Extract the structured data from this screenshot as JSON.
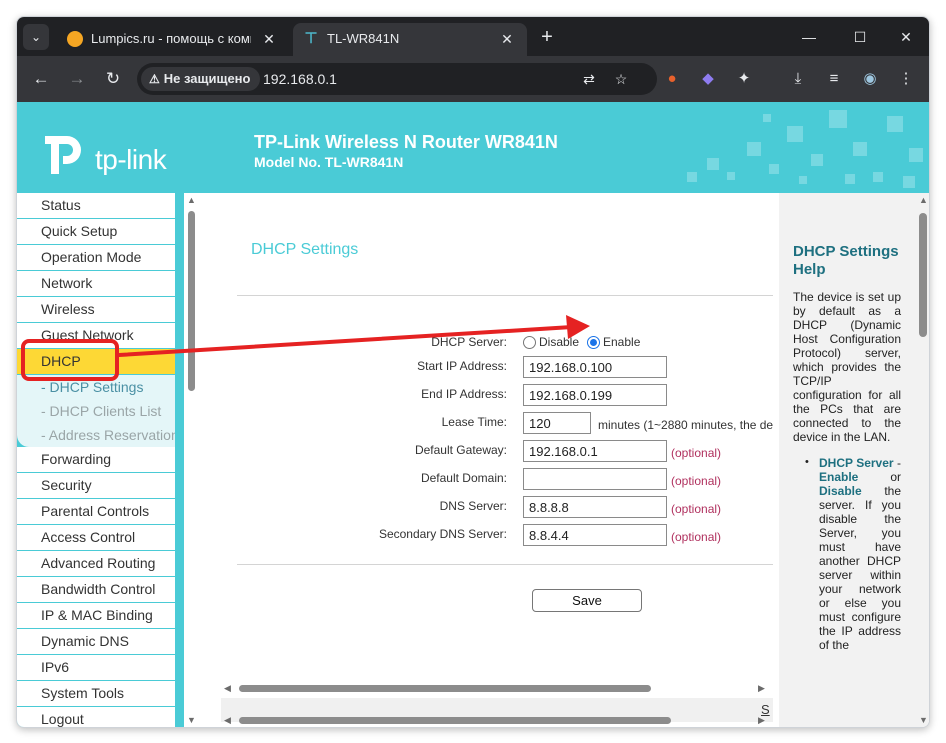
{
  "browser": {
    "tabs": [
      {
        "title": "Lumpics.ru - помощь с компь",
        "close": "✕"
      },
      {
        "title": "TL-WR841N",
        "close": "✕"
      }
    ],
    "tab_menu_glyph": "⌄",
    "new_tab_glyph": "+",
    "window_controls": {
      "minimize": "—",
      "maximize": "☐",
      "close": "✕"
    },
    "nav": {
      "back": "←",
      "forward": "→",
      "reload": "↻"
    },
    "security_label": "Не защищено",
    "warning_glyph": "⚠",
    "url": "192.168.0.1",
    "omnibox_icons": {
      "translate": "⇄",
      "bookmark": "☆"
    },
    "toolbar_icons": {
      "extension1": "●",
      "extension2": "◆",
      "extensions": "✦",
      "download": "⤓",
      "media": "≡",
      "profile": "◉",
      "menu": "⋮"
    }
  },
  "router": {
    "logo_text": "tp-link",
    "header_title": "TP-Link Wireless N Router WR841N",
    "header_model": "Model No. TL-WR841N",
    "menu": [
      {
        "label": "Status"
      },
      {
        "label": "Quick Setup"
      },
      {
        "label": "Operation Mode"
      },
      {
        "label": "Network"
      },
      {
        "label": "Wireless"
      },
      {
        "label": "Guest Network"
      },
      {
        "label": "DHCP",
        "active": true
      }
    ],
    "submenu": [
      {
        "label": "- DHCP Settings",
        "current": true
      },
      {
        "label": "- DHCP Clients List"
      },
      {
        "label": "- Address Reservation"
      }
    ],
    "menu_after": [
      {
        "label": "Forwarding"
      },
      {
        "label": "Security"
      },
      {
        "label": "Parental Controls"
      },
      {
        "label": "Access Control"
      },
      {
        "label": "Advanced Routing"
      },
      {
        "label": "Bandwidth Control"
      },
      {
        "label": "IP & MAC Binding"
      },
      {
        "label": "Dynamic DNS"
      },
      {
        "label": "IPv6"
      },
      {
        "label": "System Tools"
      },
      {
        "label": "Logout"
      }
    ],
    "form": {
      "section_title": "DHCP Settings",
      "dhcp_server_label": "DHCP Server:",
      "disable_label": "Disable",
      "enable_label": "Enable",
      "dhcp_server_value": "Enable",
      "start_ip_label": "Start IP Address:",
      "start_ip_value": "192.168.0.100",
      "end_ip_label": "End IP Address:",
      "end_ip_value": "192.168.0.199",
      "lease_time_label": "Lease Time:",
      "lease_time_value": "120",
      "lease_time_hint": "minutes (1~2880 minutes, the de",
      "gateway_label": "Default Gateway:",
      "gateway_value": "192.168.0.1",
      "domain_label": "Default Domain:",
      "domain_value": "",
      "dns_label": "DNS Server:",
      "dns_value": "8.8.8.8",
      "dns2_label": "Secondary DNS Server:",
      "dns2_value": "8.8.4.4",
      "optional_label": "(optional)",
      "save_label": "Save",
      "clipped_link": "S"
    },
    "help": {
      "title": "DHCP Settings Help",
      "intro": "The device is set up by default as a DHCP (Dynamic Host Configuration Protocol) server, which provides the TCP/IP configuration for all the PCs that are connected to the device in the LAN.",
      "bullet_glyph": "•",
      "item_kw1": "DHCP Server",
      "item_sep": " - ",
      "item_kw2": "Enable",
      "item_or": " or ",
      "item_kw3": "Disable",
      "item_rest": " the server. If you disable the Server, you must have another DHCP server within your network or else you must configure the IP address of the"
    },
    "scroll_glyphs": {
      "up": "▲",
      "down": "▼",
      "left": "◀",
      "right": "▶"
    }
  },
  "colors": {
    "brand": "#4acbd6",
    "active_menu": "#fdd835",
    "annotation": "#e52222",
    "optional_text": "#b0305e"
  }
}
